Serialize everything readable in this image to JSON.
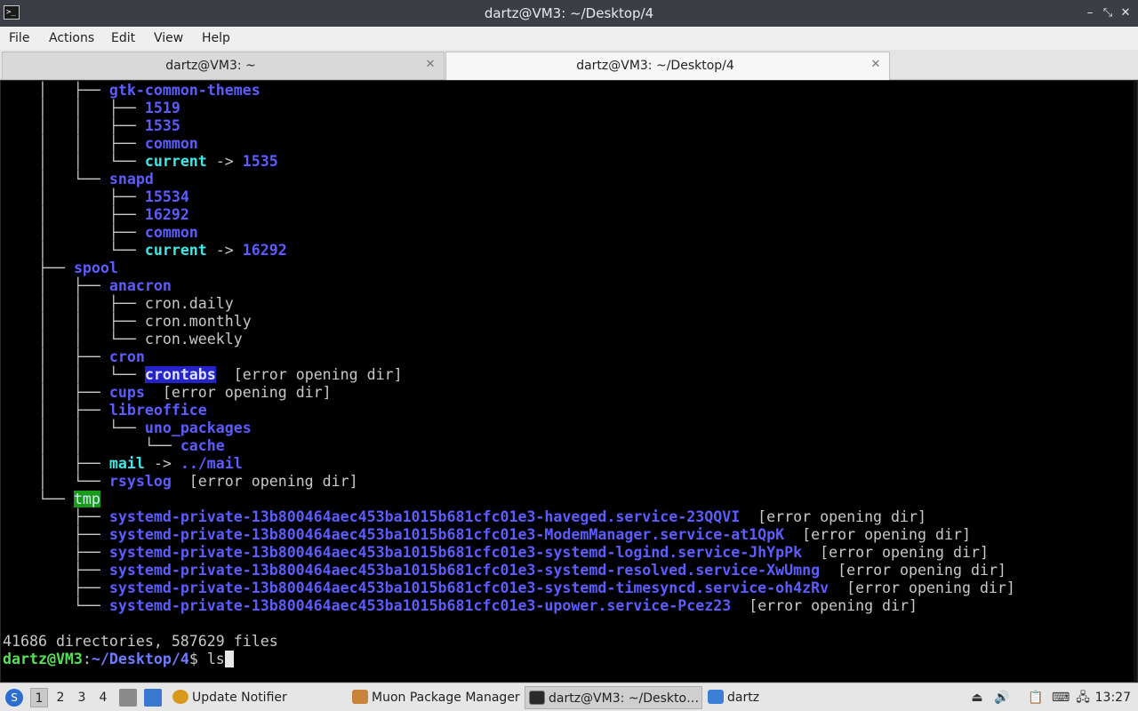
{
  "window": {
    "title": "dartz@VM3: ~/Desktop/4",
    "app_icon": ">_",
    "minimize_icon": "–",
    "maximize_icon": "⤡",
    "close_icon": "✕"
  },
  "menu": {
    "items": [
      "File",
      "Actions",
      "Edit",
      "View",
      "Help"
    ]
  },
  "tabs": [
    {
      "label": "dartz@VM3: ~",
      "close": "✕",
      "active": false
    },
    {
      "label": "dartz@VM3: ~/Desktop/4",
      "close": "✕",
      "active": true
    }
  ],
  "terminal": {
    "lines": [
      [
        {
          "t": "    │   ├── "
        },
        {
          "t": "gtk-common-themes",
          "c": "dir"
        }
      ],
      [
        {
          "t": "    │   │   ├── "
        },
        {
          "t": "1519",
          "c": "dir"
        }
      ],
      [
        {
          "t": "    │   │   ├── "
        },
        {
          "t": "1535",
          "c": "dir"
        }
      ],
      [
        {
          "t": "    │   │   ├── "
        },
        {
          "t": "common",
          "c": "dir"
        }
      ],
      [
        {
          "t": "    │   │   └── "
        },
        {
          "t": "current",
          "c": "cy"
        },
        {
          "t": " -> "
        },
        {
          "t": "1535",
          "c": "dir"
        }
      ],
      [
        {
          "t": "    │   └── "
        },
        {
          "t": "snapd",
          "c": "dir"
        }
      ],
      [
        {
          "t": "    │       ├── "
        },
        {
          "t": "15534",
          "c": "dir"
        }
      ],
      [
        {
          "t": "    │       ├── "
        },
        {
          "t": "16292",
          "c": "dir"
        }
      ],
      [
        {
          "t": "    │       ├── "
        },
        {
          "t": "common",
          "c": "dir"
        }
      ],
      [
        {
          "t": "    │       └── "
        },
        {
          "t": "current",
          "c": "cy"
        },
        {
          "t": " -> "
        },
        {
          "t": "16292",
          "c": "dir"
        }
      ],
      [
        {
          "t": "    ├── "
        },
        {
          "t": "spool",
          "c": "dir"
        }
      ],
      [
        {
          "t": "    │   ├── "
        },
        {
          "t": "anacron",
          "c": "dir"
        }
      ],
      [
        {
          "t": "    │   │   ├── cron.daily"
        }
      ],
      [
        {
          "t": "    │   │   ├── cron.monthly"
        }
      ],
      [
        {
          "t": "    │   │   └── cron.weekly"
        }
      ],
      [
        {
          "t": "    │   ├── "
        },
        {
          "t": "cron",
          "c": "dir"
        }
      ],
      [
        {
          "t": "    │   │   └── "
        },
        {
          "t": "crontabs",
          "c": "hl"
        },
        {
          "t": "  [error opening dir]"
        }
      ],
      [
        {
          "t": "    │   ├── "
        },
        {
          "t": "cups",
          "c": "dir"
        },
        {
          "t": "  [error opening dir]"
        }
      ],
      [
        {
          "t": "    │   ├── "
        },
        {
          "t": "libreoffice",
          "c": "dir"
        }
      ],
      [
        {
          "t": "    │   │   └── "
        },
        {
          "t": "uno_packages",
          "c": "dir"
        }
      ],
      [
        {
          "t": "    │   │       └── "
        },
        {
          "t": "cache",
          "c": "dir"
        }
      ],
      [
        {
          "t": "    │   ├── "
        },
        {
          "t": "mail",
          "c": "cy"
        },
        {
          "t": " -> "
        },
        {
          "t": "../mail",
          "c": "dir"
        }
      ],
      [
        {
          "t": "    │   └── "
        },
        {
          "t": "rsyslog",
          "c": "dir"
        },
        {
          "t": "  [error opening dir]"
        }
      ],
      [
        {
          "t": "    └── "
        },
        {
          "t": "tmp",
          "c": "tmp"
        }
      ],
      [
        {
          "t": "        ├── "
        },
        {
          "t": "systemd-private-13b800464aec453ba1015b681cfc01e3-haveged.service-23QQVI",
          "c": "dir"
        },
        {
          "t": "  [error opening dir]"
        }
      ],
      [
        {
          "t": "        ├── "
        },
        {
          "t": "systemd-private-13b800464aec453ba1015b681cfc01e3-ModemManager.service-at1QpK",
          "c": "dir"
        },
        {
          "t": "  [error opening dir]"
        }
      ],
      [
        {
          "t": "        ├── "
        },
        {
          "t": "systemd-private-13b800464aec453ba1015b681cfc01e3-systemd-logind.service-JhYpPk",
          "c": "dir"
        },
        {
          "t": "  [error opening dir]"
        }
      ],
      [
        {
          "t": "        ├── "
        },
        {
          "t": "systemd-private-13b800464aec453ba1015b681cfc01e3-systemd-resolved.service-XwUmng",
          "c": "dir"
        },
        {
          "t": "  [error opening dir]"
        }
      ],
      [
        {
          "t": "        ├── "
        },
        {
          "t": "systemd-private-13b800464aec453ba1015b681cfc01e3-systemd-timesyncd.service-oh4zRv",
          "c": "dir"
        },
        {
          "t": "  [error opening dir]"
        }
      ],
      [
        {
          "t": "        └── "
        },
        {
          "t": "systemd-private-13b800464aec453ba1015b681cfc01e3-upower.service-Pcez23",
          "c": "dir"
        },
        {
          "t": "  [error opening dir]"
        }
      ],
      [
        {
          "t": ""
        }
      ],
      [
        {
          "t": "41686 directories, 587629 files"
        }
      ]
    ],
    "prompt": {
      "user_host": "dartz@VM3",
      "sep": ":",
      "path": "~/Desktop/4",
      "symbol": "$ ",
      "input": "ls"
    }
  },
  "taskbar": {
    "start_icon": "S",
    "workspaces": [
      "1",
      "2",
      "3",
      "4"
    ],
    "active_workspace": "1",
    "tasks": [
      {
        "label": "Update Notifier",
        "icon_color": "#d89a1c"
      },
      {
        "label": "Muon Package Manager",
        "icon_color": "#c8843a"
      },
      {
        "label": "dartz@VM3: ~/Deskto…",
        "icon_color": "#2a2a2a"
      },
      {
        "label": "dartz",
        "icon_color": "#3d7fd6"
      }
    ],
    "tray_icons": [
      "eject-icon",
      "volume-icon",
      "clipboard-icon",
      "keyboard-icon",
      "network-icon"
    ],
    "clock": "13:27"
  }
}
